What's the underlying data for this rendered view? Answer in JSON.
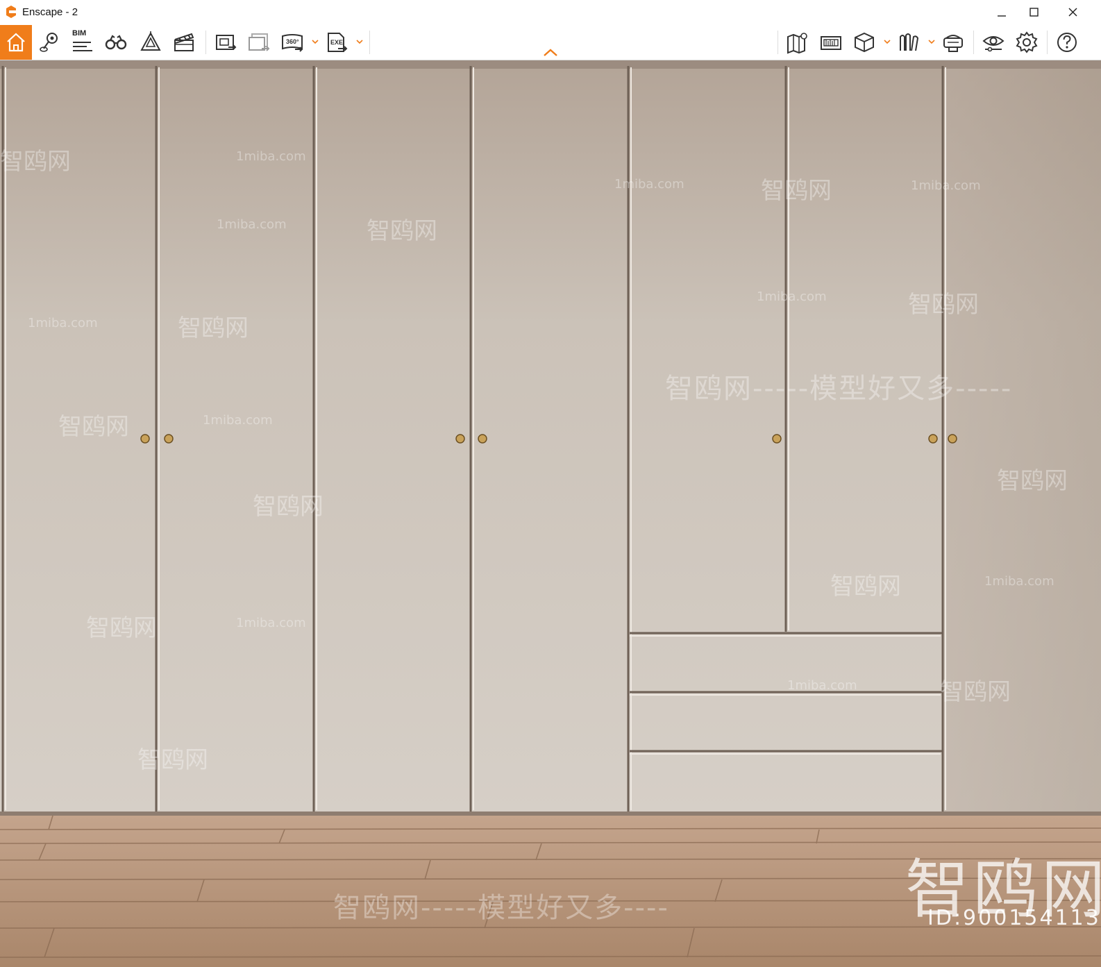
{
  "window": {
    "title": "Enscape - 2"
  },
  "toolbar": {
    "bim_label": "BIM",
    "items": [
      {
        "name": "home",
        "icon": "home-icon"
      },
      {
        "name": "views",
        "icon": "map-pin-icon"
      },
      {
        "name": "bim",
        "icon": "bim-lines-icon"
      },
      {
        "name": "walk",
        "icon": "binoculars-icon"
      },
      {
        "name": "assets",
        "icon": "asset-library-icon"
      },
      {
        "name": "video",
        "icon": "clapperboard-icon"
      },
      {
        "name": "screenshot",
        "icon": "render-export-icon"
      },
      {
        "name": "batch",
        "icon": "batch-render-icon"
      },
      {
        "name": "panorama",
        "icon": "panorama-360-icon"
      },
      {
        "name": "exe",
        "icon": "exe-export-icon"
      },
      {
        "name": "map",
        "icon": "map-icon"
      },
      {
        "name": "dimension",
        "icon": "ruler-board-icon"
      },
      {
        "name": "cube",
        "icon": "cube-icon"
      },
      {
        "name": "books",
        "icon": "books-icon"
      },
      {
        "name": "vr",
        "icon": "vr-headset-icon"
      },
      {
        "name": "visual",
        "icon": "eye-icon"
      },
      {
        "name": "settings",
        "icon": "gear-icon"
      },
      {
        "name": "help",
        "icon": "help-icon"
      }
    ]
  },
  "watermark": {
    "brand": "智鸥网",
    "site": "1miba.com",
    "slogan": "智鸥网-----模型好又多----",
    "slogan_right": "智鸥网-----模型好又多-----",
    "id_text": "ID:900154113"
  },
  "colors": {
    "accent": "#f07d1a",
    "wardrobe": "#d3cbc2",
    "gold_handle": "#c9a25a",
    "floor": "#b08a6c"
  }
}
